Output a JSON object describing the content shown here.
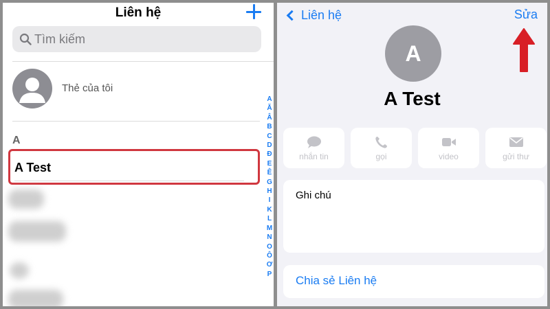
{
  "left": {
    "title": "Liên hệ",
    "search_placeholder": "Tìm kiếm",
    "my_card_label": "Thẻ của tôi",
    "section_header": "A",
    "contact_name": "A Test",
    "index_letters": [
      "A",
      "Ă",
      "Â",
      "B",
      "C",
      "D",
      "Đ",
      "E",
      "Ê",
      "G",
      "H",
      "I",
      "K",
      "L",
      "M",
      "N",
      "O",
      "Ô",
      "Ơ",
      "P"
    ],
    "add_icon": "plus-icon",
    "highlight_color": "#d0373f"
  },
  "right": {
    "back_label": "Liên hệ",
    "edit_label": "Sửa",
    "avatar_initial": "A",
    "contact_name": "A Test",
    "actions": [
      {
        "label": "nhắn tin",
        "icon": "message-icon"
      },
      {
        "label": "gọi",
        "icon": "phone-icon"
      },
      {
        "label": "video",
        "icon": "video-icon"
      },
      {
        "label": "gửi thư",
        "icon": "mail-icon"
      }
    ],
    "notes_label": "Ghi chú",
    "share_label": "Chia sẻ Liên hệ",
    "arrow_color": "#d81f26"
  },
  "colors": {
    "accent": "#1a7cf2",
    "background": "#f2f2f7"
  }
}
